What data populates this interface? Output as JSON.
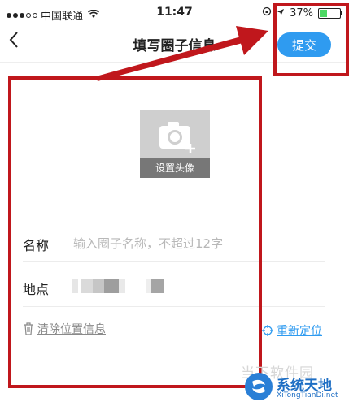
{
  "status_bar": {
    "carrier": "中国联通",
    "time": "11:47",
    "battery": "37%",
    "battery_level": 0.37
  },
  "nav": {
    "title": "填写圈子信息",
    "submit_label": "提交"
  },
  "avatar": {
    "label": "设置头像"
  },
  "form": {
    "name_label": "名称",
    "name_placeholder": "输入圈子名称，不超过12字",
    "name_value": "",
    "location_label": "地点"
  },
  "actions": {
    "clear_location": "清除位置信息",
    "relocate": "重新定位"
  },
  "watermark": {
    "text": "当下软件园",
    "brand": "系统天地",
    "brand_url": "XiTongTianDi.net"
  },
  "colors": {
    "accent": "#2f9bf0",
    "annotation": "#c0171c"
  }
}
